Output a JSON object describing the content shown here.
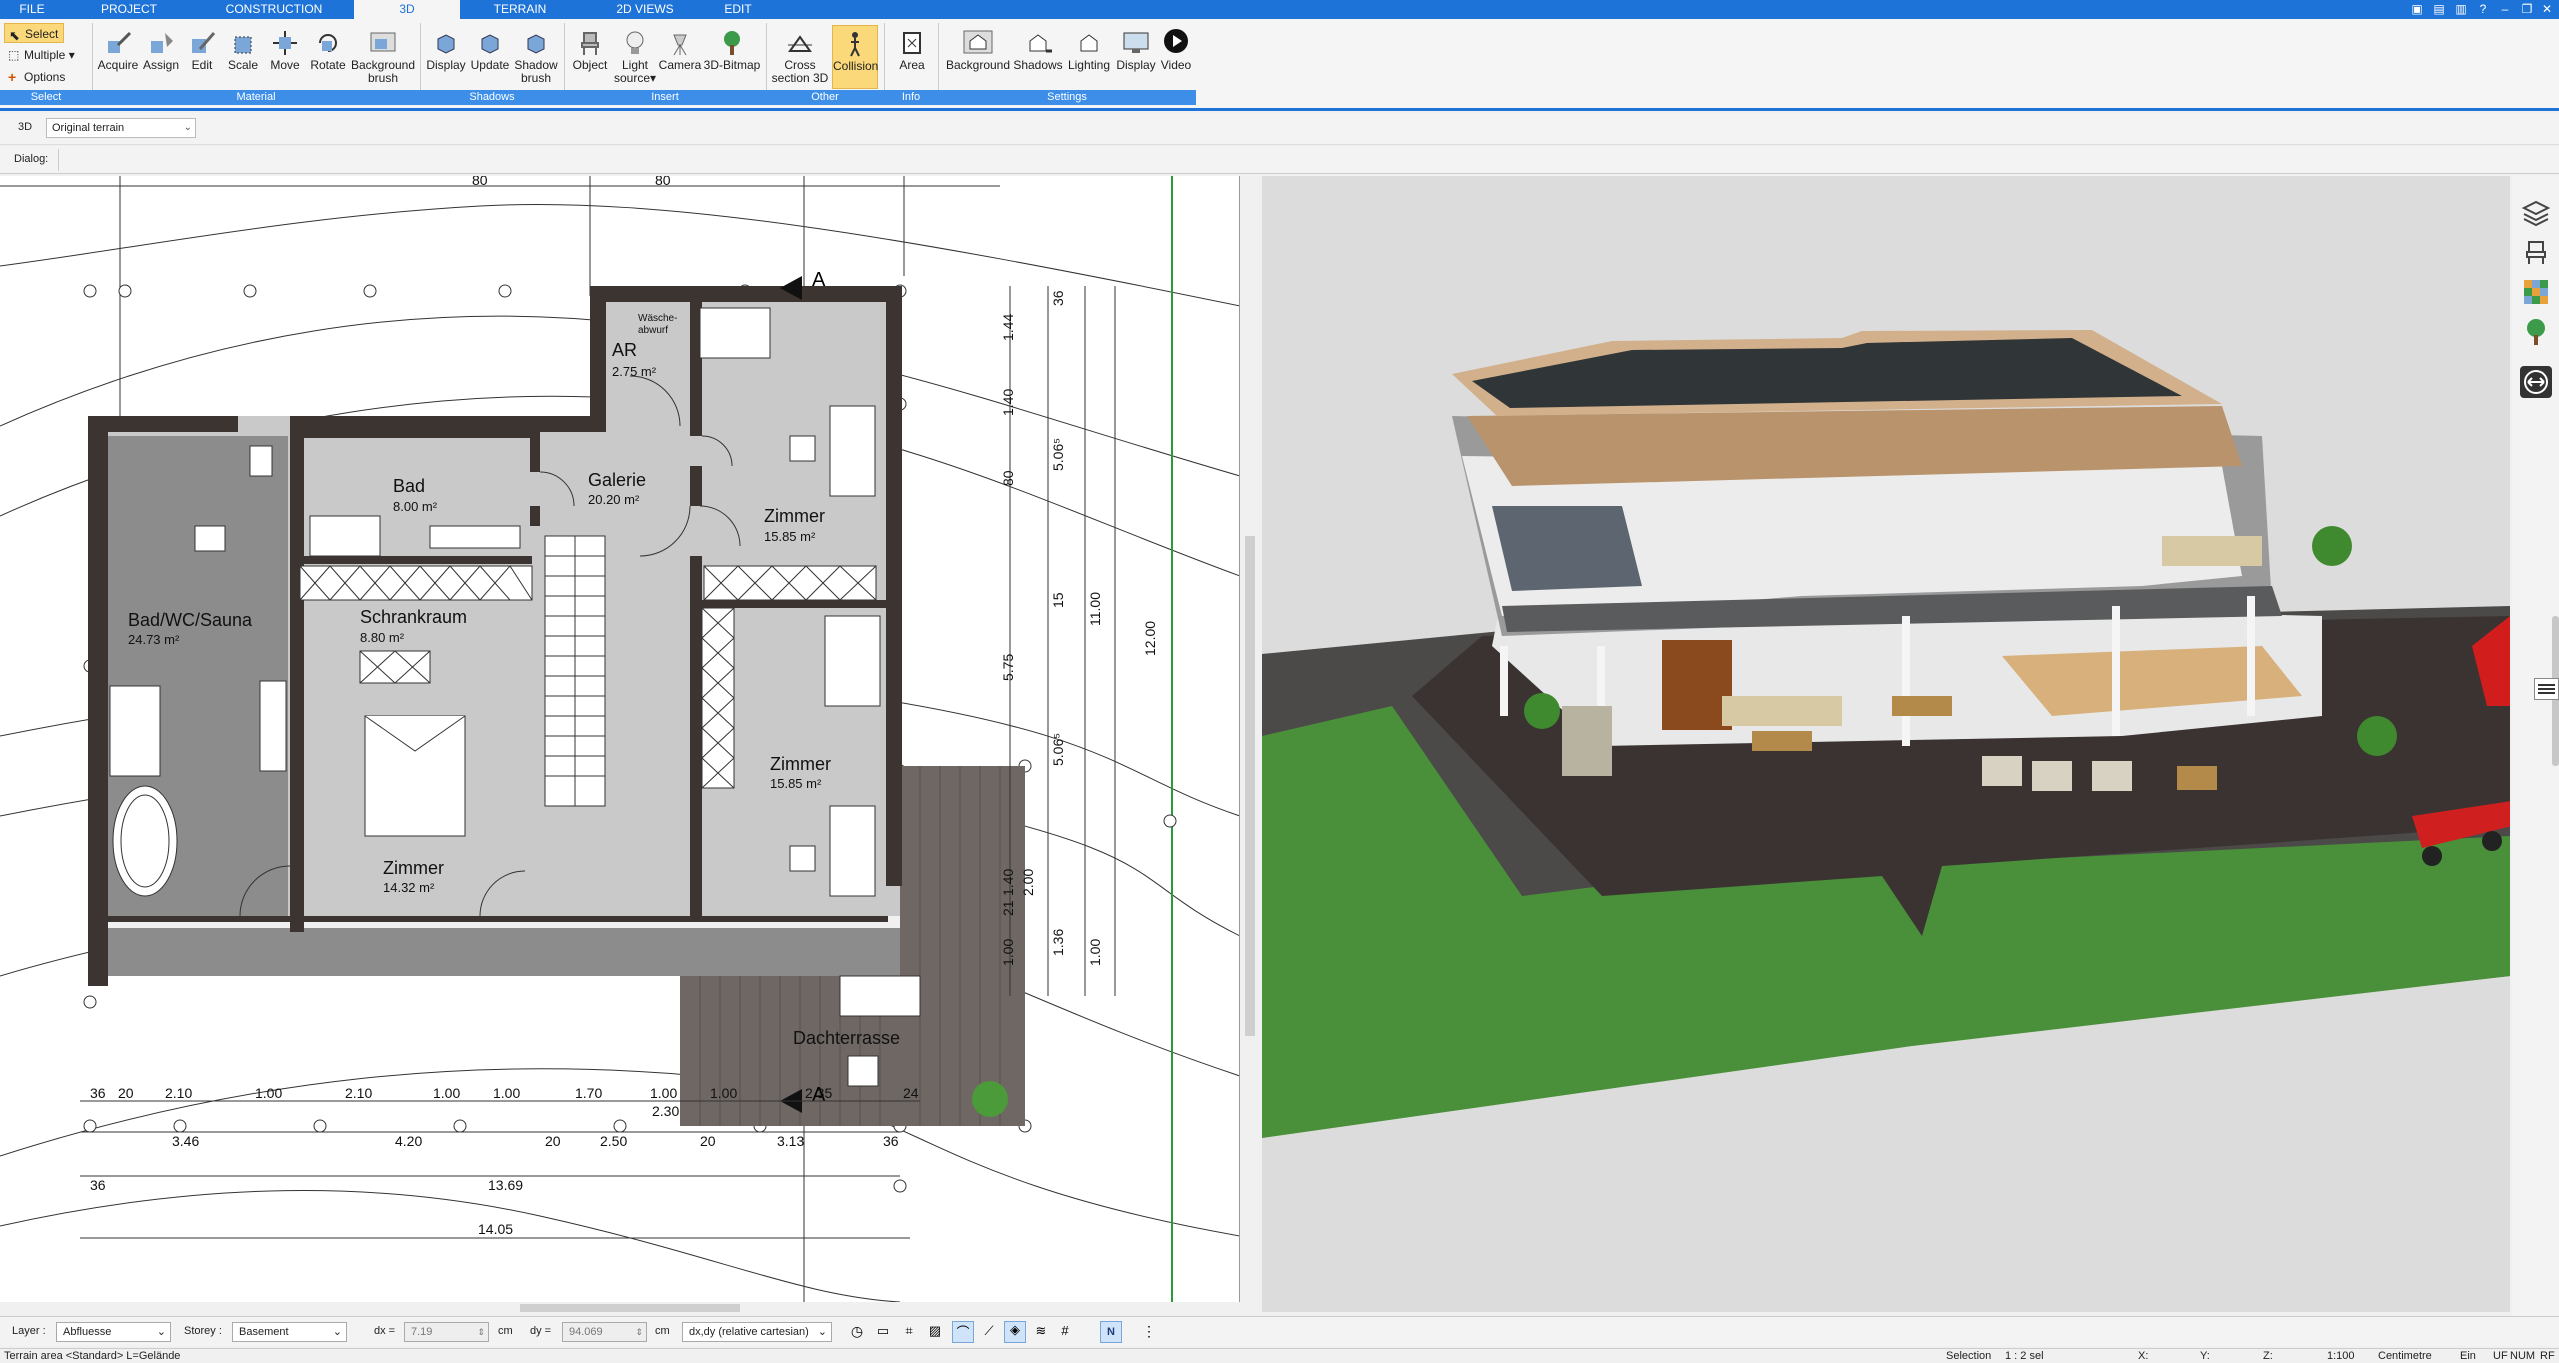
{
  "menu": {
    "tabs": [
      {
        "id": "file",
        "label": "FILE"
      },
      {
        "id": "project",
        "label": "PROJECT"
      },
      {
        "id": "construction",
        "label": "CONSTRUCTION"
      },
      {
        "id": "3d",
        "label": "3D",
        "active": true
      },
      {
        "id": "terrain",
        "label": "TERRAIN"
      },
      {
        "id": "2dviews",
        "label": "2D VIEWS"
      },
      {
        "id": "edit",
        "label": "EDIT"
      }
    ]
  },
  "ribbon": {
    "select": {
      "select": "Select",
      "multiple": "Multiple",
      "options": "Options"
    },
    "material": {
      "acquire": "Acquire",
      "assign": "Assign",
      "edit": "Edit",
      "scale": "Scale",
      "move": "Move",
      "rotate": "Rotate",
      "background_brush_1": "Background",
      "background_brush_2": "brush"
    },
    "shadows": {
      "display": "Display",
      "update": "Update",
      "shadow_brush_1": "Shadow",
      "shadow_brush_2": "brush"
    },
    "insert": {
      "object": "Object",
      "light_1": "Light",
      "light_2": "source",
      "camera": "Camera",
      "bitmap": "3D-Bitmap"
    },
    "other": {
      "cross_1": "Cross",
      "cross_2": "section 3D",
      "collision": "Collision"
    },
    "info": {
      "area": "Area"
    },
    "settings": {
      "background": "Background",
      "shadows": "Shadows",
      "lighting": "Lighting",
      "display": "Display",
      "video": "Video"
    },
    "groups": {
      "select": "Select",
      "material": "Material",
      "shadows": "Shadows",
      "insert": "Insert",
      "other": "Other",
      "info": "Info",
      "settings": "Settings"
    }
  },
  "toolbar2": {
    "mode": "3D",
    "terrain_value": "Original terrain"
  },
  "dialog": {
    "label": "Dialog:"
  },
  "plan": {
    "rooms": [
      {
        "name": "AR",
        "area": "2.75 m²"
      },
      {
        "name": "Bad",
        "area": "8.00 m²"
      },
      {
        "name": "Galerie",
        "area": "20.20 m²"
      },
      {
        "name": "Zimmer",
        "area": "15.85 m²"
      },
      {
        "name": "Bad/WC/Sauna",
        "area": "24.73 m²"
      },
      {
        "name": "Schrankraum",
        "area": "8.80 m²"
      },
      {
        "name": "Zimmer",
        "area": "15.85 m²"
      },
      {
        "name": "Zimmer",
        "area": "14.32 m²"
      },
      {
        "name": "Dachterrasse",
        "area": ""
      }
    ],
    "laundry_1": "Wäsche-",
    "laundry_2": "abwurf",
    "section_mark": "A",
    "top_dims": [
      "80",
      "80"
    ],
    "bottom_dims_row1": [
      "36",
      "20",
      "2.10",
      "1.00",
      "2.10",
      "1.00",
      "1.00",
      "1.70",
      "1.00",
      "1.00",
      "2.35",
      "24"
    ],
    "bottom_dims_row2": [
      "3.46",
      "4.20",
      "20",
      "2.50",
      "20",
      "3.13",
      "36",
      "2.30"
    ],
    "bottom_dims_row3": [
      "36",
      "13.69"
    ],
    "bottom_dims_row4": [
      "14.05"
    ],
    "right_dims_a": [
      "36",
      "1.44",
      "1.40",
      "80",
      "15",
      "5.75",
      "1.40",
      "21",
      "1.00",
      "1.36"
    ],
    "right_dims_b": [
      "5.06⁵",
      "5.06⁵",
      "2.00"
    ],
    "right_dims_c": [
      "11.00",
      "1.00"
    ],
    "right_dims_d": [
      "12.00"
    ]
  },
  "statusbar": {
    "layer_label": "Layer :",
    "layer_value": "Abfluesse",
    "storey_label": "Storey :",
    "storey_value": "Basement",
    "dx_label": "dx =",
    "dx_value": "7.19",
    "dx_unit": "cm",
    "dy_label": "dy =",
    "dy_value": "94.069",
    "dy_unit": "cm",
    "coord_mode": "dx,dy (relative cartesian)",
    "info": "Terrain area <Standard> L=Gelände",
    "selection_label": "Selection",
    "selection_value": "1 : 2 sel",
    "x_label": "X:",
    "y_label": "Y:",
    "z_label": "Z:",
    "scale": "1:100",
    "unit": "Centimetre",
    "ein": "Ein",
    "uf": "UF",
    "num": "NUM",
    "rf": "RF"
  },
  "colors": {
    "accent": "#1e73d8",
    "ribbon_group": "#3c8ee9",
    "active_button": "#fbd97b",
    "grass": "#4a8f3a",
    "wall": "#3b3431",
    "floor": "#c9c9c9"
  }
}
